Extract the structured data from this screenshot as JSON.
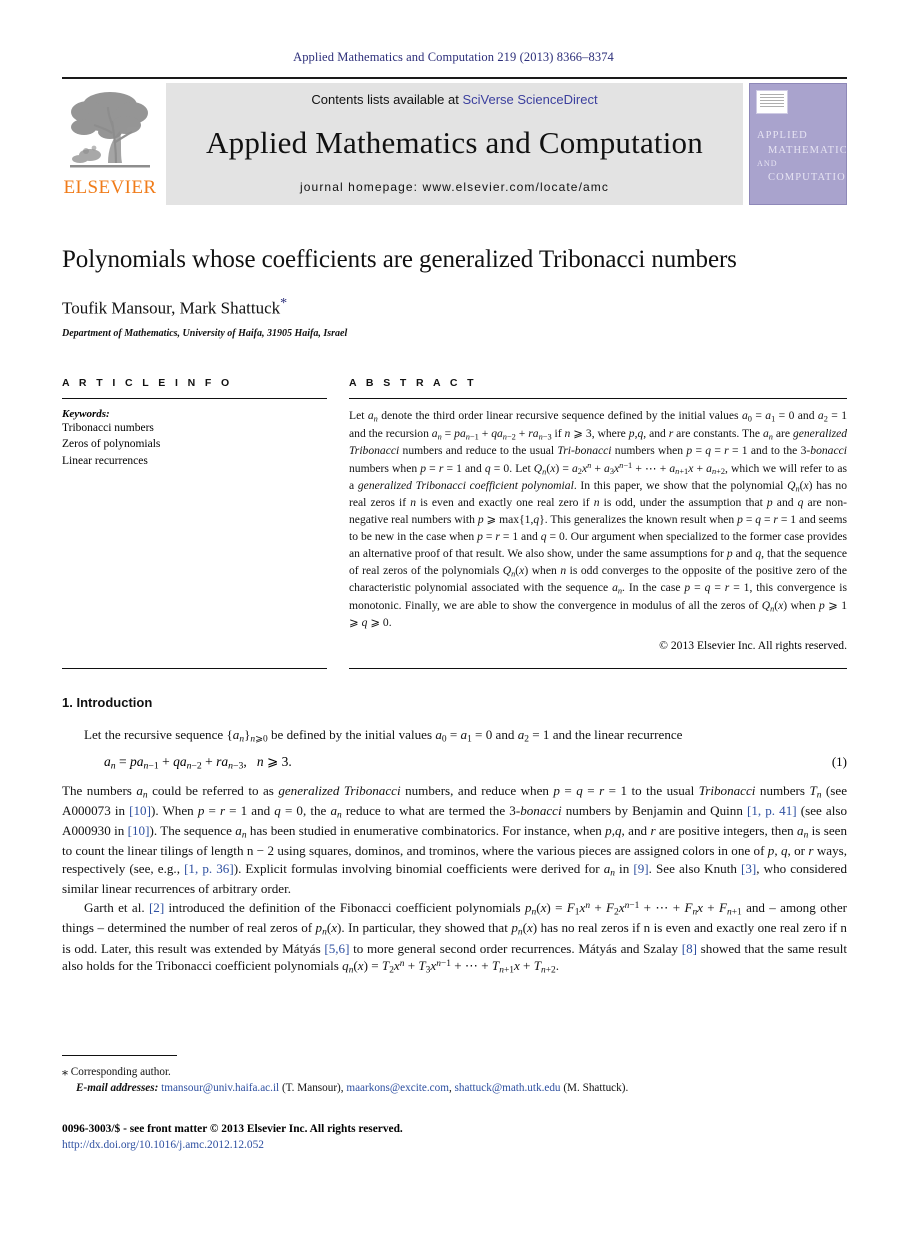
{
  "running_head": "Applied Mathematics and Computation 219 (2013) 8366–8374",
  "masthead": {
    "publisher": "ELSEVIER",
    "contents_prefix": "Contents lists available at ",
    "sciencedirect": "SciVerse ScienceDirect",
    "journal_title": "Applied Mathematics and Computation",
    "homepage": "journal homepage: www.elsevier.com/locate/amc",
    "cover": {
      "line1": "APPLIED",
      "line2": "MATHEMATICS",
      "line3": "AND",
      "line4": "COMPUTATION"
    }
  },
  "article": {
    "title": "Polynomials whose coefficients are generalized Tribonacci numbers",
    "authors": "Toufik Mansour, Mark Shattuck",
    "corresponding_marker": "*",
    "affiliation": "Department of Mathematics, University of Haifa, 31905 Haifa, Israel"
  },
  "info": {
    "heading": "A R T I C L E   I N F O",
    "keywords_label": "Keywords:",
    "keywords": [
      "Tribonacci numbers",
      "Zeros of polynomials",
      "Linear recurrences"
    ]
  },
  "abstract": {
    "heading": "A B S T R A C T",
    "copyright": "© 2013 Elsevier Inc. All rights reserved."
  },
  "introduction": {
    "heading": "1. Introduction",
    "equation_number": "(1)"
  },
  "footnotes": {
    "corresponding": "Corresponding author.",
    "email_label": "E-mail addresses:",
    "email1": "tmansour@univ.haifa.ac.il",
    "email1_who": " (T. Mansour), ",
    "email2": "maarkons@excite.com",
    "email2_sep": ", ",
    "email3": "shattuck@math.utk.edu",
    "email3_who": " (M. Shattuck)."
  },
  "imprint": {
    "issn_line": "0096-3003/$ - see front matter © 2013 Elsevier Inc. All rights reserved.",
    "doi": "http://dx.doi.org/10.1016/j.amc.2012.12.052"
  },
  "colors": {
    "link": "#2d4fa0",
    "running_head": "#2d2f7a",
    "elsevier_orange": "#f07c1a",
    "cover_purple": "#a9a3cd",
    "banner_grey": "#e3e3e3"
  }
}
